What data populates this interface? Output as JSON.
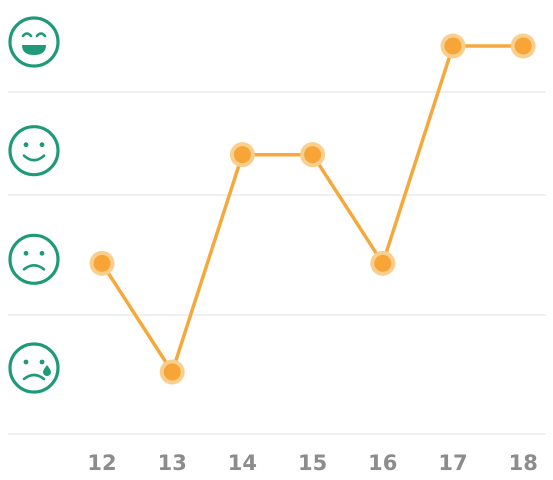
{
  "chart_data": {
    "type": "line",
    "x": [
      "12",
      "13",
      "14",
      "15",
      "16",
      "17",
      "18"
    ],
    "series": [
      {
        "values": [
          2,
          1,
          3,
          3,
          2,
          4,
          4
        ]
      }
    ],
    "y_levels": [
      {
        "value": 4,
        "icon": "laughing-face-icon"
      },
      {
        "value": 3,
        "icon": "smiling-face-icon"
      },
      {
        "value": 2,
        "icon": "sad-face-icon"
      },
      {
        "value": 1,
        "icon": "crying-face-icon"
      }
    ],
    "ylim": [
      1,
      4
    ],
    "grid": true,
    "legend": "none"
  },
  "colors": {
    "line": "#f5a93c",
    "marker": "#f7a537",
    "marker_halo": "#f9cf8e",
    "icon": "#1e9a78",
    "grid": "#e6e6e6",
    "tick_label": "#8c8c8c"
  }
}
